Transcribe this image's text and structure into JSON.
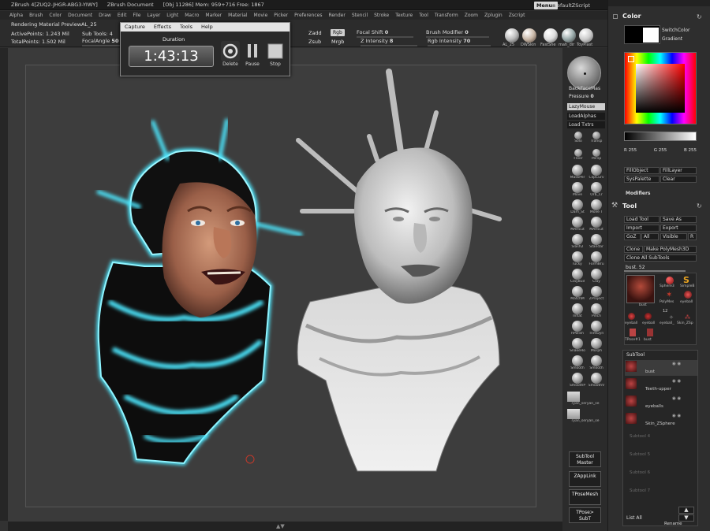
{
  "titlebar": {
    "app": "ZBrush 4[ZUQ2-JHGR-ABG3-YIWY]",
    "document": "ZBrush Document",
    "stats": "[Obj 11286]  Mem: 959+716  Free: 1867",
    "menus_label": "Menus",
    "script": "DefaultZScript"
  },
  "menubar": {
    "items": [
      "Alpha",
      "Brush",
      "Color",
      "Document",
      "Draw",
      "Edit",
      "File",
      "Layer",
      "Light",
      "Macro",
      "Marker",
      "Material",
      "Movie",
      "Picker",
      "Preferences",
      "Render",
      "Stencil",
      "Stroke",
      "Texture",
      "Tool",
      "Transform",
      "Zoom",
      "Zplugin",
      "Zscript"
    ]
  },
  "topshelf": {
    "rendering": "Rendering Material PreviewAL_25",
    "active_points": "ActivePoints: 1.243 Mil",
    "total_points": "TotalPoints: 1.502 Mil",
    "subtools": "Sub Tools: 4",
    "focal_angle_label": "FocalAngle",
    "focal_angle_value": "50",
    "zadd": "Zadd",
    "zsub": "Zsub",
    "rgb": "Rgb",
    "mrgb": "Mrgb",
    "focal_shift": "Focal Shift",
    "focal_shift_value": "0",
    "z_intensity": "Z Intensity",
    "z_intensity_value": "8",
    "brush_modifier": "Brush Modifier",
    "brush_modifier_value": "0",
    "rgb_intensity": "Rgb Intensity",
    "rgb_intensity_value": "70",
    "mat_labels": [
      "AL_25",
      "DWSkin",
      "FastShe",
      "mah_dir",
      "ToyPlast"
    ]
  },
  "capture_window": {
    "menu": [
      "Capture",
      "Effects",
      "Tools",
      "Help"
    ],
    "duration_label": "Duration",
    "time": "1:43:13",
    "delete_label": "Delete",
    "pause_label": "Pause",
    "stop_label": "Stop"
  },
  "right_tray": {
    "backface": "BackFaceMas",
    "pressure": "Pressure",
    "pressure_value": "0",
    "lazymouse": "LazyMouse",
    "load_alphas": "LoadAlphas",
    "load_txtrs": "Load Txtrs",
    "view_labels": [
      "Solo",
      "Transp",
      "Floor",
      "Persp"
    ],
    "brushes": [
      "MaskPer",
      "ClipCurv",
      "Move",
      "Orb_Cr",
      "Dam_St",
      "Move T",
      "MAHcut",
      "MAHcut",
      "Slash2",
      "Standar",
      "lucky",
      "FormBru",
      "ClayBuil",
      "Clay",
      "MatchM",
      "ZProject",
      "Inflat",
      "Pinch",
      "hPolish",
      "TrimDyn",
      "SnakeHo",
      "Morph",
      "Smooth",
      "Smooth",
      "SmoothP",
      "SmoothV"
    ],
    "alpha_labels": [
      "ryan_seryan_se",
      "ryan_seryan_se"
    ],
    "subtool_master": "SubTool Master",
    "zapplink": "ZAppLink",
    "tpose_mesh": "TPoseMesh",
    "tpose_subt": "TPose> SubT"
  },
  "color_palette": {
    "title": "Color",
    "switch_color": "SwitchColor",
    "gradient": "Gradient",
    "r": "R 255",
    "g": "G 255",
    "b": "B 255",
    "fill_object": "FillObject",
    "fill_layer": "FillLayer",
    "sys_palette": "SysPalette",
    "clear": "Clear",
    "modifiers": "Modifiers"
  },
  "tool_palette": {
    "title": "Tool",
    "load_tool": "Load Tool",
    "save_as": "Save As",
    "import": "Import",
    "export": "Export",
    "goz": "GoZ",
    "all": "All",
    "visible": "Visible",
    "r": "R",
    "clone": "Clone",
    "make_polymesh": "Make PolyMesh3D",
    "clone_all": "Clone  All SubTools",
    "current_tool": "bust. 52",
    "tool_thumbs": [
      "bust",
      "Sphere3",
      "SimpleB",
      "PolyMes",
      "eyeball",
      "eyeball",
      "eyeball",
      "eyeball_",
      "Skin_ZSp",
      "TPose#1",
      "bust"
    ],
    "thumb_count": "12"
  },
  "subtool_palette": {
    "title": "SubTool",
    "items": [
      "bust",
      "Teeth-upper",
      "eyeballs",
      "Skin_ZSphere"
    ],
    "empty_slots": [
      "Subtool 4",
      "Subtool 5",
      "Subtool 6",
      "Subtool 7"
    ],
    "list_all": "List All",
    "rename": "Rename"
  },
  "colors": {
    "accent_glow": "#4de8ff",
    "panel": "#2e2e2e",
    "canvas": "#3d3d3d"
  }
}
